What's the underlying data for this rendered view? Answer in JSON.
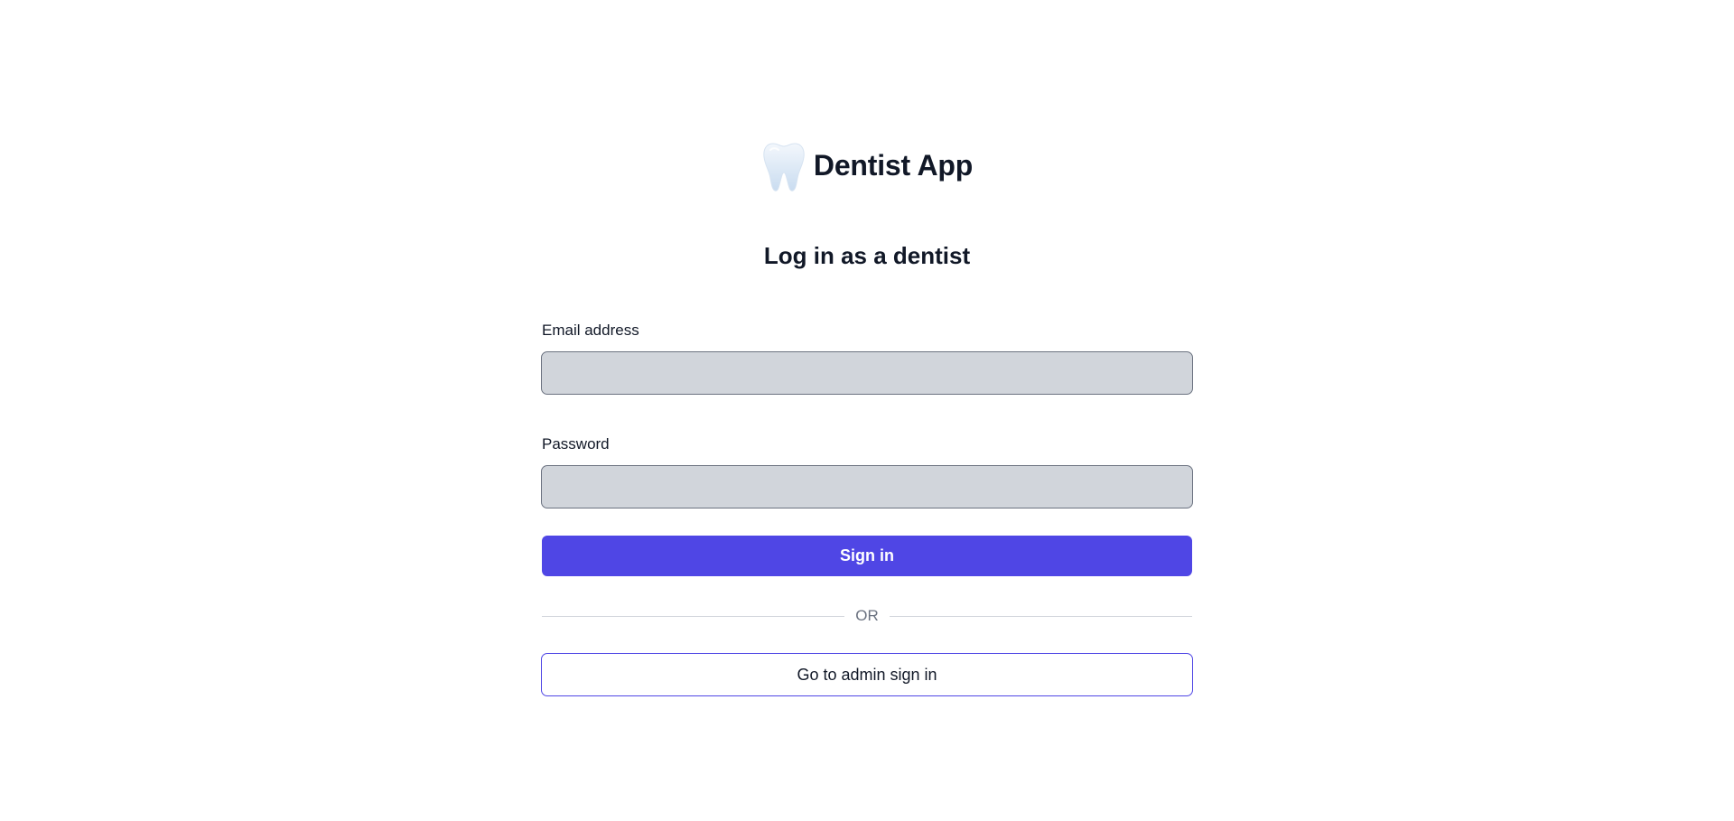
{
  "brand": {
    "title": "Dentist App",
    "icon": "tooth-icon"
  },
  "heading": "Log in as a dentist",
  "form": {
    "email": {
      "label": "Email address",
      "value": "",
      "placeholder": ""
    },
    "password": {
      "label": "Password",
      "value": "",
      "placeholder": ""
    },
    "submit_label": "Sign in",
    "divider_text": "OR",
    "admin_link_label": "Go to admin sign in"
  },
  "colors": {
    "primary": "#4f46e5",
    "input_bg": "#d1d5db",
    "input_border": "#6b7280",
    "text": "#111827",
    "muted": "#6b7280"
  }
}
